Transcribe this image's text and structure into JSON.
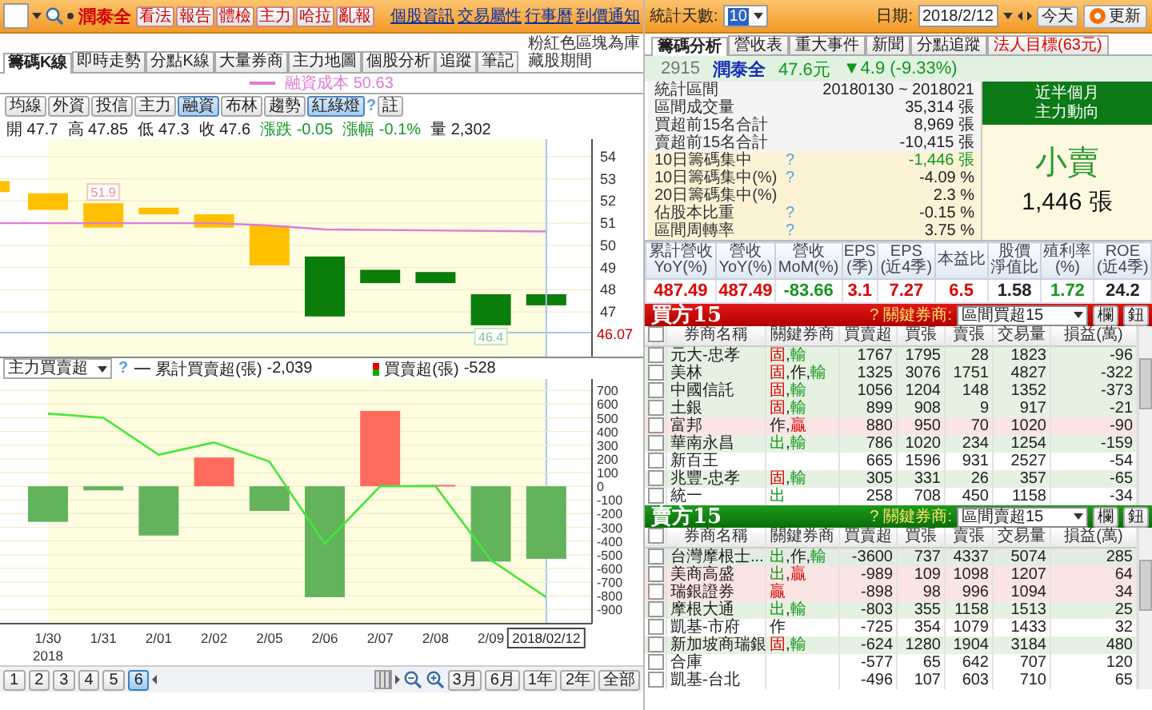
{
  "toolbar": {
    "stock_name": "潤泰全",
    "actions": [
      "看法",
      "報告",
      "體檢",
      "主力",
      "哈拉",
      "亂報"
    ],
    "links": [
      "個股資訊",
      "交易屬性",
      "行事曆",
      "到價通知"
    ]
  },
  "chart_tabs": [
    {
      "label": "籌碼K線",
      "selected": true
    },
    {
      "label": "即時走勢",
      "selected": false
    },
    {
      "label": "分點K線",
      "selected": false
    },
    {
      "label": "大量券商",
      "selected": false
    },
    {
      "label": "主力地圖",
      "selected": false
    },
    {
      "label": "個股分析",
      "selected": false
    },
    {
      "label": "追蹤",
      "selected": false
    },
    {
      "label": "筆記",
      "selected": false
    }
  ],
  "chart_note": "粉紅色區塊為庫藏股期間",
  "price_chart": {
    "legend": "融資成本 50.63",
    "indicators": [
      {
        "label": "均線",
        "selected": false
      },
      {
        "label": "外資",
        "selected": false
      },
      {
        "label": "投信",
        "selected": false
      },
      {
        "label": "主力",
        "selected": false
      },
      {
        "label": "融資",
        "selected": true
      },
      {
        "label": "布林",
        "selected": false
      },
      {
        "label": "趨勢",
        "selected": false
      },
      {
        "label": "紅綠燈",
        "selected": true
      }
    ],
    "help": "?",
    "note_button": "註",
    "quote": [
      {
        "label": "開",
        "value": "47.7",
        "color": "#222222"
      },
      {
        "label": "高",
        "value": "47.85",
        "color": "#222222"
      },
      {
        "label": "低",
        "value": "47.3",
        "color": "#222222"
      },
      {
        "label": "收",
        "value": "47.6",
        "color": "#222222"
      },
      {
        "label": "漲跌",
        "value": "-0.05",
        "color": "#14961e"
      },
      {
        "label": "漲幅",
        "value": "-0.1%",
        "color": "#14961e"
      },
      {
        "label": "量",
        "value": "2,302",
        "color": "#222222"
      }
    ],
    "axis": [
      "54",
      "53",
      "52",
      "51",
      "50",
      "49",
      "48",
      "47"
    ],
    "last_price": "46.07",
    "high_mark": "51.9",
    "low_mark": "46.4"
  },
  "flow_chart": {
    "selector": "主力買賣超",
    "help": "?",
    "line_total": "-2,039",
    "bar_total": "-528",
    "year_label": "2018",
    "chart_data": {
      "type": "bar",
      "grid": true,
      "categories": [
        "1/30",
        "1/31",
        "2/01",
        "2/02",
        "2/05",
        "2/06",
        "2/07",
        "2/08",
        "2/09",
        "2018/02/12"
      ],
      "series": [
        {
          "name": "買賣超(張)",
          "values": [
            -260,
            -30,
            -360,
            210,
            -180,
            -810,
            550,
            10,
            -550,
            -530
          ],
          "colors": [
            "#63b35d",
            "#63b35d",
            "#63b35d",
            "#ff6a5e",
            "#63b35d",
            "#63b35d",
            "#ff6a5e",
            "#ff6a5e",
            "#63b35d",
            "#63b35d"
          ]
        },
        {
          "name": "累計買賣超(張)",
          "type": "line",
          "color": "#44e83a",
          "values": [
            530,
            500,
            230,
            320,
            180,
            -420,
            0,
            0,
            -540,
            -810
          ]
        }
      ],
      "ylim": [
        -980,
        760
      ],
      "yticks": [
        700,
        600,
        500,
        400,
        300,
        200,
        100,
        0,
        -100,
        -200,
        -300,
        -400,
        -500,
        -600,
        -700,
        -800,
        -900
      ]
    }
  },
  "pager": {
    "pages": [
      {
        "label": "1",
        "selected": false
      },
      {
        "label": "2",
        "selected": false
      },
      {
        "label": "3",
        "selected": false
      },
      {
        "label": "4",
        "selected": false
      },
      {
        "label": "5",
        "selected": false
      },
      {
        "label": "6",
        "selected": true
      }
    ],
    "ranges": [
      "3月",
      "6月",
      "1年",
      "2年",
      "全部"
    ]
  },
  "stats_toolbar": {
    "days_label": "統計天數:",
    "days": "10",
    "date_label": "日期:",
    "date": "2018/2/12",
    "today": "今天",
    "refresh": "更新"
  },
  "stats_tabs": [
    {
      "label": "籌碼分析",
      "selected": true,
      "kind": "normal"
    },
    {
      "label": "營收表",
      "selected": false,
      "kind": "normal"
    },
    {
      "label": "重大事件",
      "selected": false,
      "kind": "normal"
    },
    {
      "label": "新聞",
      "selected": false,
      "kind": "normal"
    },
    {
      "label": "分點追蹤",
      "selected": false,
      "kind": "normal"
    },
    {
      "label": "法人目標(63元)",
      "selected": false,
      "kind": "alert"
    }
  ],
  "stock": {
    "code": "2915",
    "name": "潤泰全",
    "price": "47.6元",
    "change": "▼4.9 (-9.33%)"
  },
  "stats": [
    {
      "label": "統計區間",
      "value": {
        "text": "20180130 ~ 2018021",
        "color": "#222222"
      },
      "color": "#f4f4f4"
    },
    {
      "label": "區間成交量",
      "value": {
        "text": "35,314 張",
        "color": "#222222"
      },
      "color": "#f4f4f4"
    },
    {
      "label": "買超前15名合計",
      "value": {
        "text": "8,969 張",
        "color": "#222222"
      },
      "color": "#f4f4f4"
    },
    {
      "label": "賣超前15名合計",
      "value": {
        "text": "-10,415 張",
        "color": "#222222"
      },
      "color": "#f4f4f4"
    },
    {
      "label": "10日籌碼集中",
      "help": "?",
      "value": {
        "text": "-1,446 張",
        "color": "#14961e"
      },
      "color": "#fcf3d6"
    },
    {
      "label": "10日籌碼集中(%)",
      "help": "?",
      "value": {
        "text": "-4.09 %",
        "color": "#222222"
      },
      "color": "#fcf3d6"
    },
    {
      "label": "20日籌碼集中(%)",
      "value": {
        "text": "2.3 %",
        "color": "#222222"
      },
      "color": "#fcf3d6"
    },
    {
      "label": "佔股本比重",
      "help": "?",
      "value": {
        "text": "-0.15 %",
        "color": "#222222"
      },
      "color": "#fcf3d6"
    },
    {
      "label": "區間周轉率",
      "help": "?",
      "value": {
        "text": "3.75 %",
        "color": "#222222"
      },
      "color": "#fcf3d6"
    }
  ],
  "trend_box": {
    "title_lines": [
      "近半個月",
      "主力動向"
    ],
    "verdict": "小賣",
    "amount": "1,446 張"
  },
  "fundamentals": [
    {
      "lines": [
        "累計營收",
        "YoY(%)"
      ],
      "value": "487.49",
      "color": "#e00000"
    },
    {
      "lines": [
        "營收",
        "YoY(%)"
      ],
      "value": "487.49",
      "color": "#e00000"
    },
    {
      "lines": [
        "營收",
        "MoM(%)"
      ],
      "value": "-83.66",
      "color": "#14961e"
    },
    {
      "lines": [
        "EPS",
        "(季)"
      ],
      "value": "3.1",
      "color": "#e00000"
    },
    {
      "lines": [
        "EPS",
        "(近4季)"
      ],
      "value": "7.27",
      "color": "#e00000"
    },
    {
      "lines": [
        "本益比"
      ],
      "value": "6.5",
      "color": "#e00000"
    },
    {
      "lines": [
        "股價",
        "淨值比"
      ],
      "value": "1.58",
      "color": "#222222"
    },
    {
      "lines": [
        "殖利率",
        "(%)"
      ],
      "value": "1.72",
      "color": "#14961e"
    },
    {
      "lines": [
        "ROE",
        "(近4季)"
      ],
      "value": "24.2",
      "color": "#222222"
    }
  ],
  "buy_table": {
    "title": "買方15",
    "help": "?",
    "key_label": "關鍵券商:",
    "selector": "區間買超15",
    "buttons": [
      "欄",
      "鈕"
    ],
    "all_checked": false,
    "columns": [
      "券商名稱",
      "關鍵券商",
      "買賣超",
      "買張",
      "賣張",
      "交易量",
      "損益(萬)"
    ],
    "rows": [
      {
        "checked": false,
        "color": "#e6f2e1",
        "cells": [
          "元大-忠孝",
          [
            {
              "text": "固",
              "color": "#e00000"
            },
            {
              "text": ","
            },
            {
              "text": "輸",
              "color": "#14961e"
            }
          ],
          "1767",
          "1795",
          "28",
          "1823",
          "-96"
        ]
      },
      {
        "checked": false,
        "color": "#e6f2e1",
        "cells": [
          "美林",
          [
            {
              "text": "固",
              "color": "#e00000"
            },
            {
              "text": ",作,"
            },
            {
              "text": "輸",
              "color": "#14961e"
            }
          ],
          "1325",
          "3076",
          "1751",
          "4827",
          "-322"
        ]
      },
      {
        "checked": false,
        "color": "#e6f2e1",
        "cells": [
          "中國信託",
          [
            {
              "text": "固",
              "color": "#e00000"
            },
            {
              "text": ","
            },
            {
              "text": "輸",
              "color": "#14961e"
            }
          ],
          "1056",
          "1204",
          "148",
          "1352",
          "-373"
        ]
      },
      {
        "checked": false,
        "color": "#e6f2e1",
        "cells": [
          "土銀",
          [
            {
              "text": "固",
              "color": "#e00000"
            },
            {
              "text": ","
            },
            {
              "text": "輸",
              "color": "#14961e"
            }
          ],
          "899",
          "908",
          "9",
          "917",
          "-21"
        ]
      },
      {
        "checked": false,
        "color": "#fbe4e4",
        "cells": [
          "富邦",
          [
            {
              "text": "作,"
            },
            {
              "text": "贏",
              "color": "#e00000"
            }
          ],
          "880",
          "950",
          "70",
          "1020",
          "-90"
        ]
      },
      {
        "checked": false,
        "color": "#e6f2e1",
        "cells": [
          "華南永昌",
          [
            {
              "text": "出",
              "color": "#14961e"
            },
            {
              "text": ","
            },
            {
              "text": "輸",
              "color": "#14961e"
            }
          ],
          "786",
          "1020",
          "234",
          "1254",
          "-159"
        ]
      },
      {
        "checked": false,
        "color": "#ffffff",
        "cells": [
          "新百王",
          [],
          "665",
          "1596",
          "931",
          "2527",
          "-54"
        ]
      },
      {
        "checked": false,
        "color": "#e6f2e1",
        "cells": [
          "兆豐-忠孝",
          [
            {
              "text": "固",
              "color": "#e00000"
            },
            {
              "text": ","
            },
            {
              "text": "輸",
              "color": "#14961e"
            }
          ],
          "305",
          "331",
          "26",
          "357",
          "-65"
        ]
      },
      {
        "checked": false,
        "color": "#ffffff",
        "cells": [
          "統一",
          [
            {
              "text": "出",
              "color": "#14961e"
            }
          ],
          "258",
          "708",
          "450",
          "1158",
          "-34"
        ]
      }
    ]
  },
  "sell_table": {
    "title": "賣方15",
    "help": "?",
    "key_label": "關鍵券商:",
    "selector": "區間賣超15",
    "buttons": [
      "欄",
      "鈕"
    ],
    "all_checked": false,
    "columns": [
      "券商名稱",
      "關鍵券商",
      "買賣超",
      "買張",
      "賣張",
      "交易量",
      "損益(萬)"
    ],
    "rows": [
      {
        "checked": false,
        "color": "#e3ece3",
        "cells": [
          "台灣摩根士...",
          [
            {
              "text": "出",
              "color": "#14961e"
            },
            {
              "text": ",作,"
            },
            {
              "text": "輸",
              "color": "#14961e"
            }
          ],
          "-3600",
          "737",
          "4337",
          "5074",
          "285"
        ]
      },
      {
        "checked": false,
        "color": "#fbe4e4",
        "cells": [
          "美商高盛",
          [
            {
              "text": "出",
              "color": "#14961e"
            },
            {
              "text": ","
            },
            {
              "text": "贏",
              "color": "#e00000"
            }
          ],
          "-989",
          "109",
          "1098",
          "1207",
          "64"
        ]
      },
      {
        "checked": false,
        "color": "#fbe4e4",
        "cells": [
          "瑞銀證券",
          [
            {
              "text": "贏",
              "color": "#e00000"
            }
          ],
          "-898",
          "98",
          "996",
          "1094",
          "34"
        ]
      },
      {
        "checked": false,
        "color": "#e6f2e1",
        "cells": [
          "摩根大通",
          [
            {
              "text": "出",
              "color": "#14961e"
            },
            {
              "text": ","
            },
            {
              "text": "輸",
              "color": "#14961e"
            }
          ],
          "-803",
          "355",
          "1158",
          "1513",
          "25"
        ]
      },
      {
        "checked": false,
        "color": "#ffffff",
        "cells": [
          "凱基-市府",
          [
            {
              "text": "作"
            }
          ],
          "-725",
          "354",
          "1079",
          "1433",
          "32"
        ]
      },
      {
        "checked": false,
        "color": "#e6f2e1",
        "cells": [
          "新加坡商瑞銀",
          [
            {
              "text": "固",
              "color": "#e00000"
            },
            {
              "text": ","
            },
            {
              "text": "輸",
              "color": "#14961e"
            }
          ],
          "-624",
          "1280",
          "1904",
          "3184",
          "480"
        ]
      },
      {
        "checked": false,
        "color": "#ffffff",
        "cells": [
          "合庫",
          [],
          "-577",
          "65",
          "642",
          "707",
          "120"
        ]
      },
      {
        "checked": false,
        "color": "#ffffff",
        "cells": [
          "凱基-台北",
          [],
          "-496",
          "107",
          "603",
          "710",
          "65"
        ]
      }
    ]
  }
}
